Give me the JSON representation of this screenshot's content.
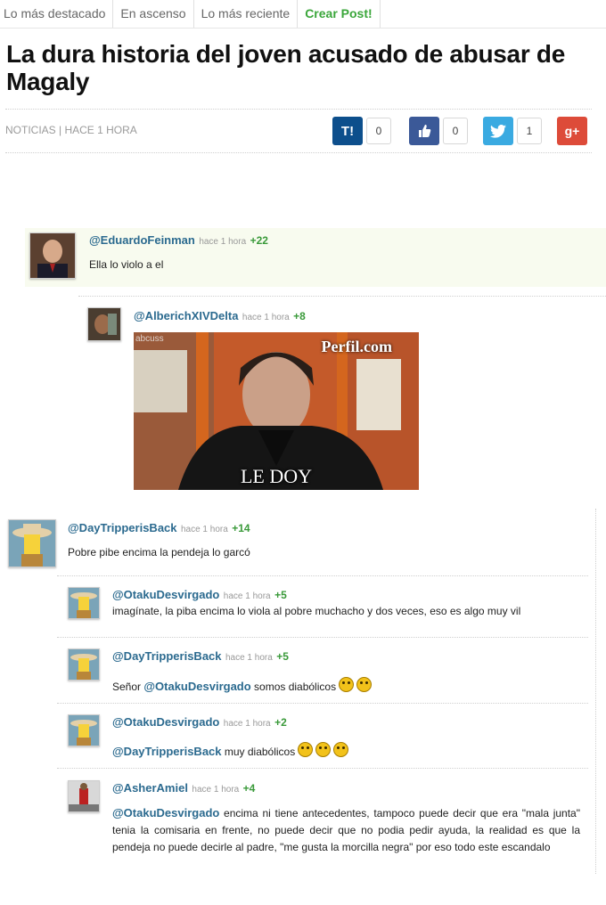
{
  "tabs": [
    "Lo más destacado",
    "En ascenso",
    "Lo más reciente",
    "Crear Post!"
  ],
  "article": {
    "title": "La dura historia del joven acusado de abusar de Magaly",
    "meta": "NOTICIAS | HACE 1 HORA"
  },
  "share": [
    {
      "icon": "taringa-icon",
      "symbol": "T!",
      "count": "0",
      "color": "#0d4f8c"
    },
    {
      "icon": "thumbs-up-icon",
      "symbol": "👍",
      "count": "0",
      "color": "#3b5998"
    },
    {
      "icon": "twitter-icon",
      "symbol": "🐦",
      "count": "1",
      "color": "#3aaae1"
    },
    {
      "icon": "google-plus-icon",
      "symbol": "g+",
      "count": "",
      "color": "#dd4b39"
    }
  ],
  "comments": [
    {
      "user": "@EduardoFeinman",
      "time": "hace 1 hora",
      "score": "+22",
      "text": "Ella lo violo a el"
    },
    {
      "user": "@AlberichXIVDelta",
      "time": "hace 1 hora",
      "score": "+8",
      "image_watermark": "Perfil.com",
      "image_caption": "LE DOY",
      "image_corner": "abcuss"
    },
    {
      "user": "@DayTripperisBack",
      "time": "hace 1 hora",
      "score": "+14",
      "text": "Pobre pibe encima la pendeja lo garcó"
    },
    {
      "user": "@OtakuDesvirgado",
      "time": "hace 1 hora",
      "score": "+5",
      "text": "imagínate, la piba encima lo viola al pobre muchacho y dos veces, eso es algo muy vil"
    },
    {
      "user": "@DayTripperisBack",
      "time": "hace 1 hora",
      "score": "+5",
      "prefix": "Señor ",
      "mention": "@OtakuDesvirgado",
      "text": " somos diabólicos"
    },
    {
      "user": "@OtakuDesvirgado",
      "time": "hace 1 hora",
      "score": "+2",
      "mention": "@DayTripperisBack",
      "text": " muy diabólicos"
    },
    {
      "user": "@AsherAmiel",
      "time": "hace 1 hora",
      "score": "+4",
      "mention": "@OtakuDesvirgado",
      "text": " encima ni tiene antecedentes, tampoco puede decir que era \"mala junta\" tenia la comisaria en frente, no puede decir que no podia pedir ayuda, la realidad es que la pendeja no puede decirle al padre, \"me gusta la morcilla negra\" por eso todo este escandalo"
    }
  ]
}
